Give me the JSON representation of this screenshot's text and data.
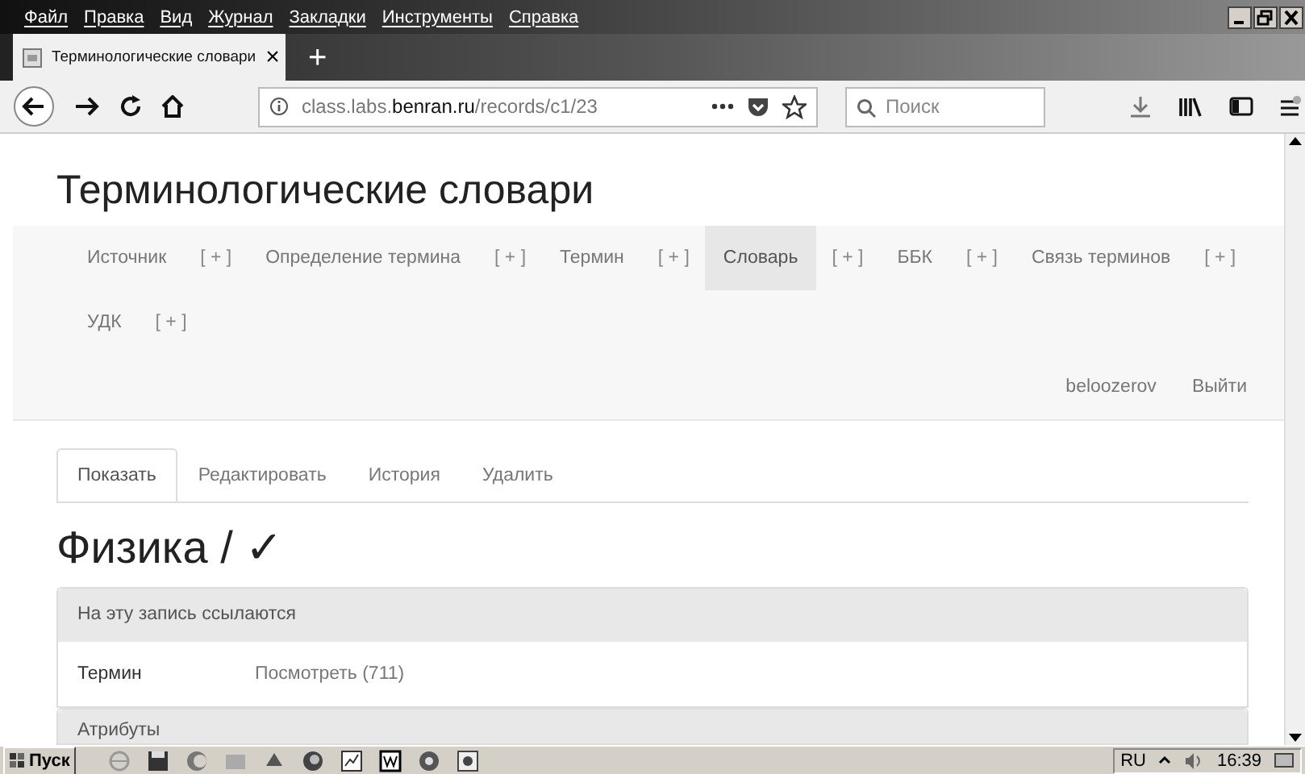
{
  "menu": [
    "Файл",
    "Правка",
    "Вид",
    "Журнал",
    "Закладки",
    "Инструменты",
    "Справка"
  ],
  "browser_tab": {
    "title": "Терминологические словари",
    "close": "×",
    "new_tab": "+"
  },
  "address_bar": {
    "url": "class.labs.**benran.ru**/records/c1/23"
  },
  "search": {
    "placeholder": "Поиск"
  },
  "page": {
    "title": "Терминологические словари",
    "nav": [
      {
        "label": "Источник",
        "kind": "link",
        "selected": false
      },
      {
        "label": "[ + ]",
        "kind": "add",
        "selected": false
      },
      {
        "label": "Определение термина",
        "kind": "link",
        "selected": false
      },
      {
        "label": "[ + ]",
        "kind": "add",
        "selected": false
      },
      {
        "label": "Термин",
        "kind": "link",
        "selected": false
      },
      {
        "label": "[ + ]",
        "kind": "add",
        "selected": false
      },
      {
        "label": "Словарь",
        "kind": "link",
        "selected": true
      },
      {
        "label": "[ + ]",
        "kind": "add",
        "selected": false
      },
      {
        "label": "ББК",
        "kind": "link",
        "selected": false
      },
      {
        "label": "[ + ]",
        "kind": "add",
        "selected": false
      },
      {
        "label": "Связь терминов",
        "kind": "link",
        "selected": false
      },
      {
        "label": "[ + ]",
        "kind": "add",
        "selected": false
      },
      {
        "label": "УДК",
        "kind": "link",
        "selected": false
      },
      {
        "label": "[ + ]",
        "kind": "add",
        "selected": false
      }
    ],
    "user": "beloozerov",
    "logout": "Выйти",
    "tabs": [
      {
        "label": "Показать",
        "selected": true
      },
      {
        "label": "Редактировать",
        "selected": false
      },
      {
        "label": "История",
        "selected": false
      },
      {
        "label": "Удалить",
        "selected": false
      }
    ],
    "heading": "Физика / ✓",
    "panels": [
      {
        "heading": "На эту запись ссылаются",
        "rows": [
          {
            "label": "Термин",
            "value": "Посмотреть (711)"
          }
        ]
      },
      {
        "heading": "Атрибуты"
      }
    ]
  },
  "taskbar": {
    "start": "Пуск",
    "language": "RU",
    "time": "16:39"
  }
}
